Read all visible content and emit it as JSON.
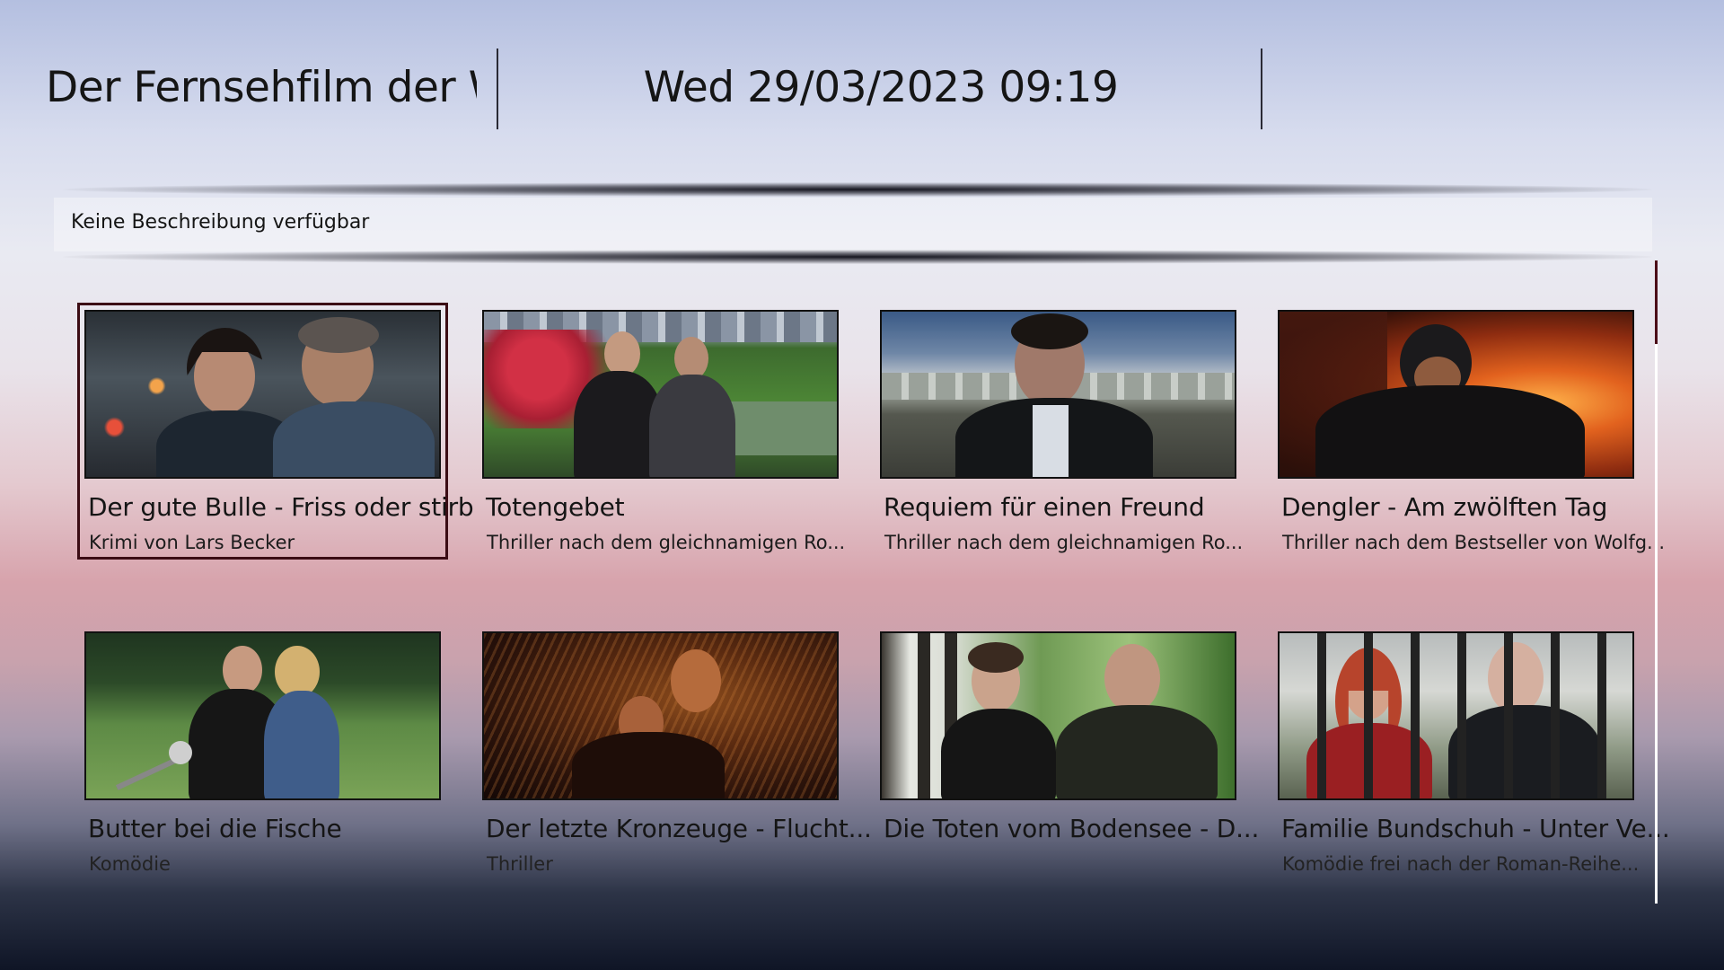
{
  "header": {
    "title": "Der Fernsehfilm der W...",
    "clock": "Wed 29/03/2023 09:19"
  },
  "description": "Keine Beschreibung verfügbar",
  "tiles": [
    {
      "title": "Der gute Bulle - Friss oder stirb",
      "subtitle": "Krimi von Lars Becker",
      "focused": true
    },
    {
      "title": "Totengebet",
      "subtitle": "Thriller nach dem gleichnamigen Ro..."
    },
    {
      "title": "Requiem für einen Freund",
      "subtitle": "Thriller nach dem gleichnamigen Ro..."
    },
    {
      "title": "Dengler - Am zwölften Tag",
      "subtitle": "Thriller nach dem Bestseller von Wolfg..."
    },
    {
      "title": "Butter bei die Fische",
      "subtitle": "Komödie"
    },
    {
      "title": "Der letzte Kronzeuge - Flucht...",
      "subtitle": "Thriller"
    },
    {
      "title": "Die Toten vom Bodensee - D...",
      "subtitle": ""
    },
    {
      "title": "Familie Bundschuh - Unter Ve...",
      "subtitle": "Komödie frei nach der Roman-Reihe..."
    }
  ],
  "scroll": {
    "position_fraction": 0.0,
    "visible_fraction": 0.13
  }
}
